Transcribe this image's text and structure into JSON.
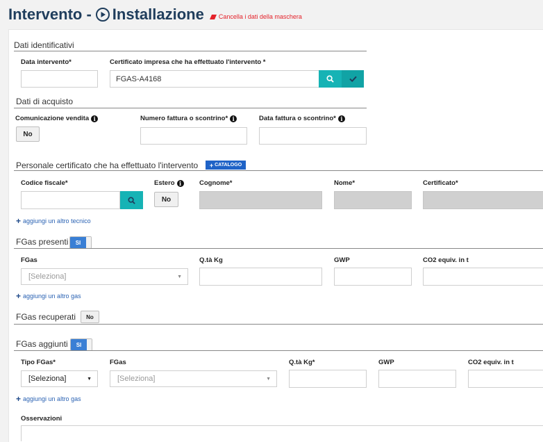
{
  "header": {
    "title_prefix": "Intervento -",
    "title_main": "Installazione",
    "clear_link": "Cancella i dati della maschera"
  },
  "identificativi": {
    "section": "Dati identificativi",
    "data_label": "Data intervento*",
    "data_value": "",
    "cert_label": "Certificato impresa che ha effettuato l'intervento *",
    "cert_value": "FGAS-A4168"
  },
  "acquisto": {
    "section": "Dati di acquisto",
    "comunicazione_label": "Comunicazione vendita",
    "comunicazione_value": "No",
    "numero_label": "Numero fattura o scontrino*",
    "numero_value": "",
    "data_label": "Data fattura o scontrino*",
    "data_value": ""
  },
  "personale": {
    "section": "Personale certificato che ha effettuato l'intervento",
    "catalogo_label": "CATALOGO",
    "codice_label": "Codice fiscale*",
    "estero_label": "Estero",
    "estero_value": "No",
    "cognome_label": "Cognome*",
    "nome_label": "Nome*",
    "certificato_label": "Certificato*",
    "add_link": "aggiungi un altro tecnico"
  },
  "presenti": {
    "section": "FGas presenti",
    "toggle": "SI",
    "fgas_label": "FGas",
    "fgas_select": "[Seleziona]",
    "qta_label": "Q.tà Kg",
    "gwp_label": "GWP",
    "co2_label": "CO2 equiv. in t",
    "add_link": "aggiungi un altro gas"
  },
  "recuperati": {
    "section": "FGas recuperati",
    "toggle": "No"
  },
  "aggiunti": {
    "section": "FGas aggiunti",
    "toggle": "SI",
    "tipo_label": "Tipo FGas*",
    "tipo_select": "[Seleziona]",
    "fgas_label": "FGas",
    "fgas_select": "[Seleziona]",
    "qta_label": "Q.tà Kg*",
    "gwp_label": "GWP",
    "co2_label": "CO2 equiv. in t",
    "add_link": "aggiungi un altro gas"
  },
  "osservazioni": {
    "label": "Osservazioni",
    "value": ""
  },
  "colors": {
    "title": "#1f3d5c",
    "teal": "#16b3b5",
    "blue": "#3a7fd5",
    "link": "#2a62b3",
    "danger": "#e4222a"
  },
  "icons": [
    "play-circle-icon",
    "eraser-icon",
    "search-icon",
    "check-icon",
    "info-icon",
    "plus-icon",
    "caret-down-icon"
  ]
}
